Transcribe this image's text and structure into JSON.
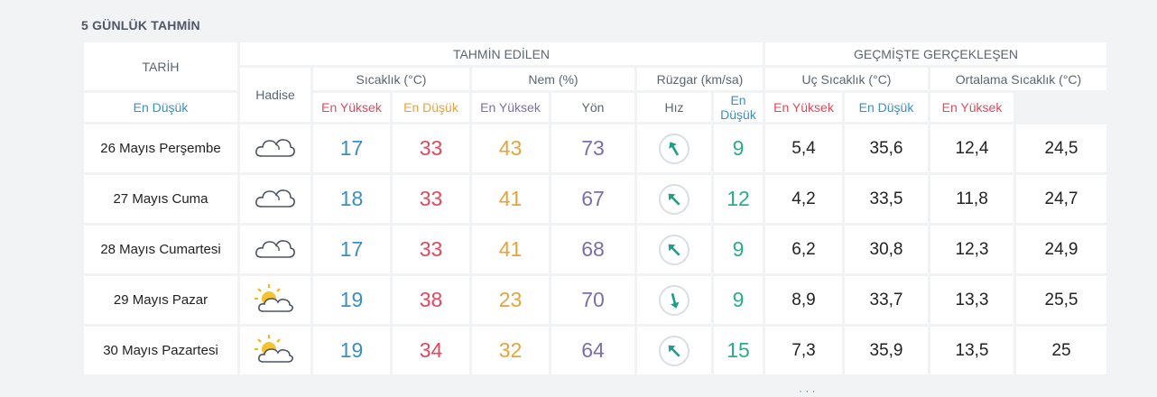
{
  "title": "5 GÜNLÜK TAHMİN",
  "headers": {
    "date": "TARİH",
    "forecast": "TAHMİN EDİLEN",
    "past": "GEÇMİŞTE GERÇEKLEŞEN",
    "event": "Hadise",
    "temp": "Sıcaklık (°C)",
    "humidity": "Nem (%)",
    "wind": "Rüzgar (km/sa)",
    "extreme_temp": "Uç Sıcaklık (°C)",
    "avg_temp": "Ortalama Sıcaklık (°C)",
    "min": "En Düşük",
    "max": "En Yüksek",
    "direction": "Yön",
    "speed": "Hız"
  },
  "rows": [
    {
      "date": "26 Mayıs Perşembe",
      "icon": "cloudy-icon",
      "tmin": "17",
      "tmax": "33",
      "hmin": "43",
      "hmax": "73",
      "wind_dir_deg": 150,
      "speed": "9",
      "uc_min": "5,4",
      "uc_max": "35,6",
      "ort_min": "12,4",
      "ort_max": "24,5"
    },
    {
      "date": "27 Mayıs Cuma",
      "icon": "cloudy-icon",
      "tmin": "18",
      "tmax": "33",
      "hmin": "41",
      "hmax": "67",
      "wind_dir_deg": 135,
      "speed": "12",
      "uc_min": "4,2",
      "uc_max": "33,5",
      "ort_min": "11,8",
      "ort_max": "24,7"
    },
    {
      "date": "28 Mayıs Cumartesi",
      "icon": "cloudy-icon",
      "tmin": "17",
      "tmax": "33",
      "hmin": "41",
      "hmax": "68",
      "wind_dir_deg": 135,
      "speed": "9",
      "uc_min": "6,2",
      "uc_max": "30,8",
      "ort_min": "12,3",
      "ort_max": "24,9"
    },
    {
      "date": "29 Mayıs Pazar",
      "icon": "partly-sunny-icon",
      "tmin": "19",
      "tmax": "38",
      "hmin": "23",
      "hmax": "70",
      "wind_dir_deg": -15,
      "speed": "9",
      "uc_min": "8,9",
      "uc_max": "33,7",
      "ort_min": "13,3",
      "ort_max": "25,5"
    },
    {
      "date": "30 Mayıs Pazartesi",
      "icon": "partly-sunny-icon",
      "tmin": "19",
      "tmax": "34",
      "hmin": "32",
      "hmax": "64",
      "wind_dir_deg": 135,
      "speed": "15",
      "uc_min": "7,3",
      "uc_max": "35,9",
      "ort_min": "13,5",
      "ort_max": "25"
    }
  ]
}
